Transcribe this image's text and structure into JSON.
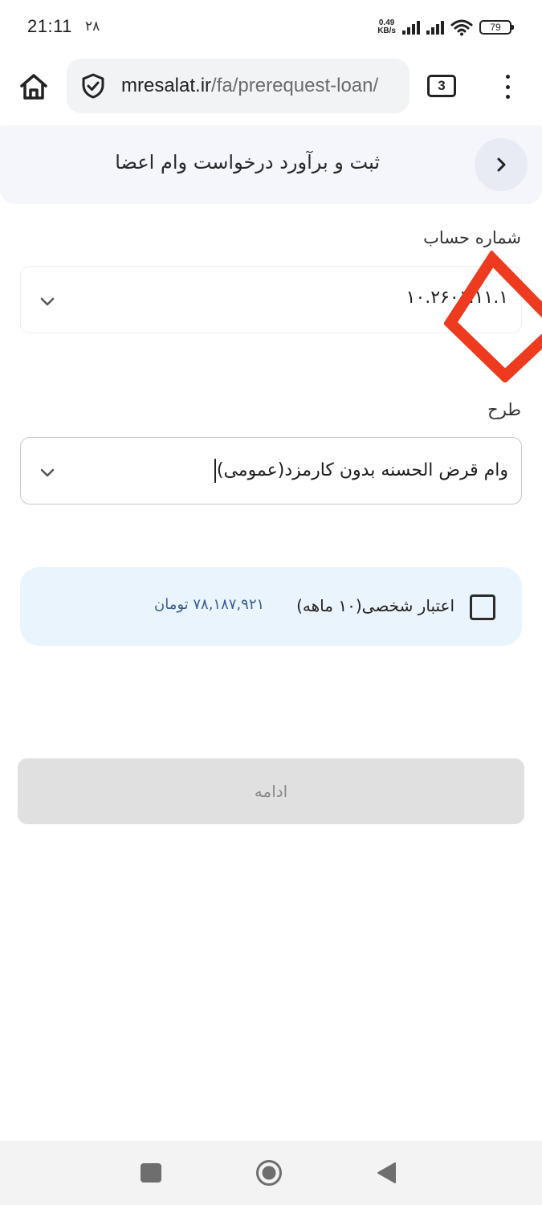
{
  "status_bar": {
    "time": "21:11",
    "date": "۲۸",
    "net_speed_value": "0.49",
    "net_speed_unit": "KB/s",
    "battery": "79"
  },
  "browser": {
    "url_host": "mresalat.ir",
    "url_path": "/fa/prerequest-loan/",
    "tab_count": "3",
    "icons": [
      "home-icon",
      "shield-icon",
      "tabs-icon",
      "more-vert-icon"
    ]
  },
  "header": {
    "title": "ثبت و برآورد درخواست وام اعضا",
    "back_icon": "chevron-right-icon"
  },
  "account": {
    "label": "شماره حساب",
    "value": "۱۰.۲۶۰۱.۱۱.۱"
  },
  "plan": {
    "label": "طرح",
    "value": "وام قرض الحسنه بدون کارمزد(عمومی)"
  },
  "credit": {
    "label": "اعتبار شخصی(۱۰ ماهه)",
    "amount": "۷۸,۱۸۷,۹۲۱ تومان",
    "checked": false
  },
  "actions": {
    "continue_label": "ادامه"
  },
  "colors": {
    "header_bg": "#f4f6fb",
    "credit_bg": "#eaf4fd",
    "amount_text": "#3a5a8c",
    "button_disabled_bg": "#e0e0e0",
    "marker_red": "#ee3a1f"
  }
}
